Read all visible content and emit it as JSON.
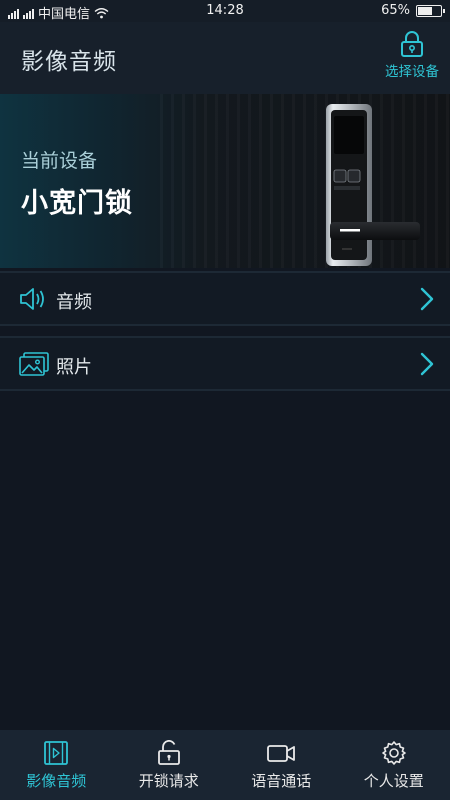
{
  "status_bar": {
    "carrier": "中国电信",
    "time": "14:28",
    "battery_percent": "65%",
    "battery_level": 0.65
  },
  "header": {
    "title": "影像音频",
    "select_device_label": "选择设备"
  },
  "banner": {
    "current_device_label": "当前设备",
    "device_name": "小宽门锁"
  },
  "menu": {
    "items": [
      {
        "label": "音频",
        "icon": "speaker-icon"
      },
      {
        "label": "照片",
        "icon": "photo-icon"
      }
    ]
  },
  "bottom_nav": {
    "items": [
      {
        "label": "影像音频",
        "icon": "video-file-icon",
        "active": true
      },
      {
        "label": "开锁请求",
        "icon": "unlock-icon",
        "active": false
      },
      {
        "label": "语音通话",
        "icon": "video-call-icon",
        "active": false
      },
      {
        "label": "个人设置",
        "icon": "gear-icon",
        "active": false
      }
    ]
  },
  "colors": {
    "accent": "#2fc4d4",
    "background": "#111721",
    "header": "#17202b",
    "bottom_nav": "#1a2532"
  }
}
